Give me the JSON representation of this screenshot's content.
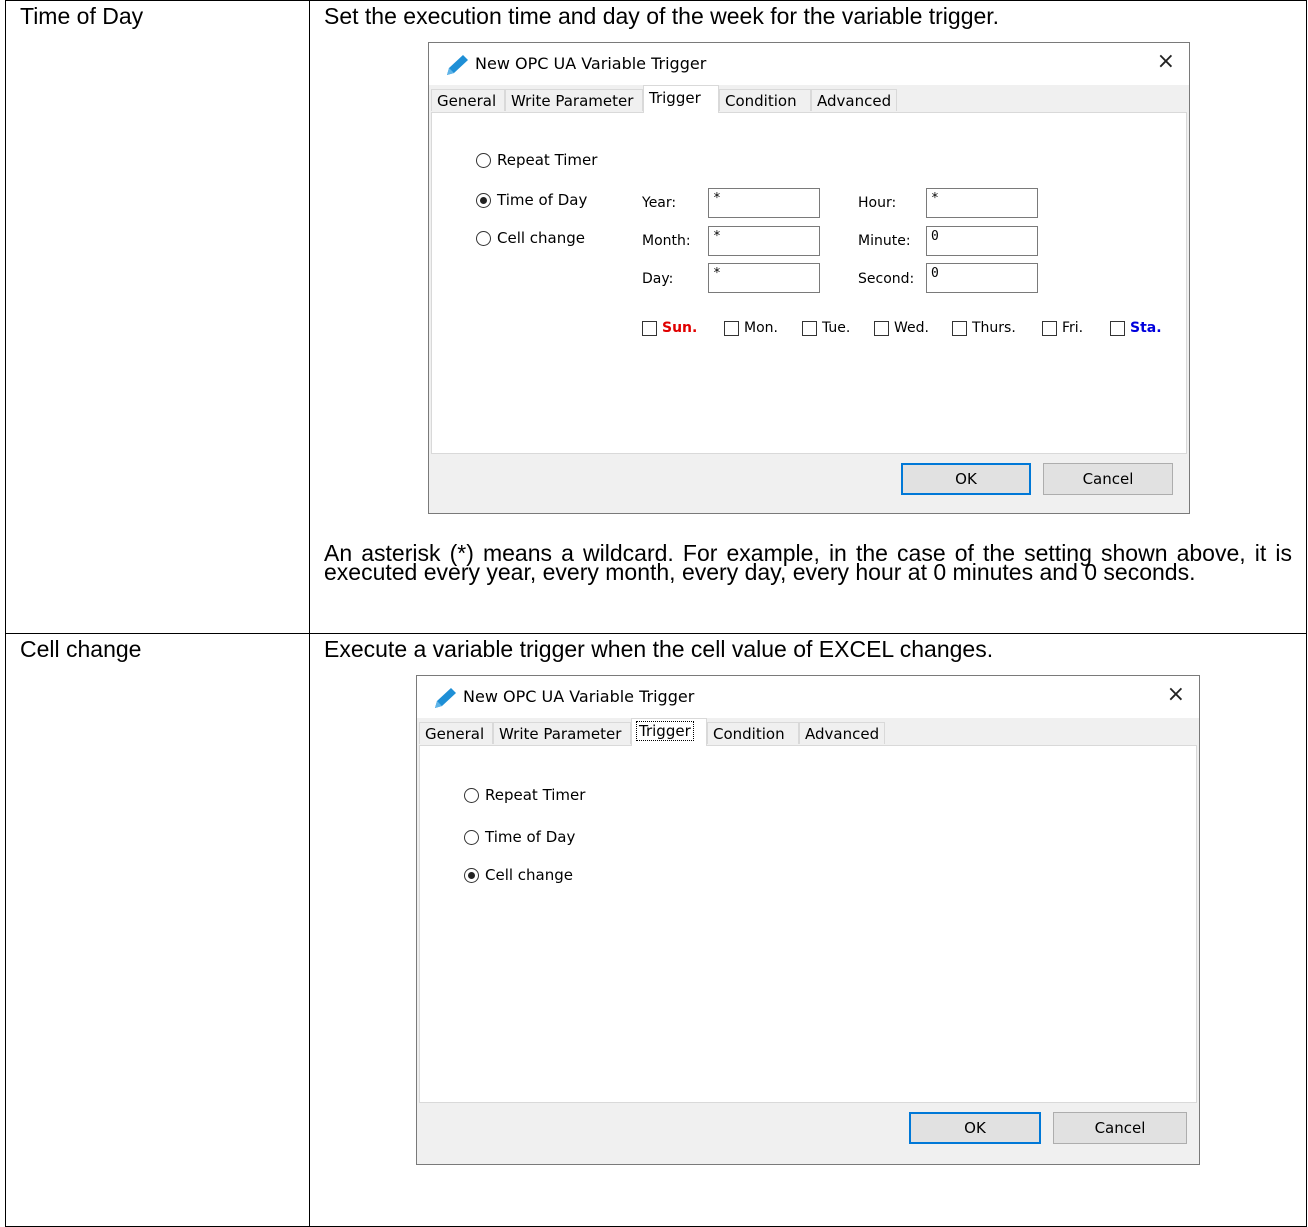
{
  "rows": [
    {
      "term": "Time of Day",
      "description": "Set the execution time and day of the week for the variable trigger.",
      "note": "An asterisk (*) means a wildcard. For example, in the case of the setting shown above, it is executed every year, every month, every day, every hour at 0 minutes and 0 seconds.",
      "dialog": {
        "title": "New OPC UA Variable Trigger",
        "close_glyph": "×",
        "tabs": [
          "General",
          "Write Parameter",
          "Trigger",
          "Condition",
          "Advanced"
        ],
        "radios": [
          "Repeat Timer",
          "Time of Day",
          "Cell change"
        ],
        "selected_radio": "Time of Day",
        "fields": {
          "year_label": "Year:",
          "year_value": "*",
          "month_label": "Month:",
          "month_value": "*",
          "day_label": "Day:",
          "day_value": "*",
          "hour_label": "Hour:",
          "hour_value": "*",
          "minute_label": "Minute:",
          "minute_value": "0",
          "second_label": "Second:",
          "second_value": "0"
        },
        "days": [
          "Sun.",
          "Mon.",
          "Tue.",
          "Wed.",
          "Thurs.",
          "Fri.",
          "Sta."
        ],
        "ok_label": "OK",
        "cancel_label": "Cancel"
      }
    },
    {
      "term": "Cell change",
      "description": "Execute a variable trigger when the cell value of EXCEL changes.",
      "dialog": {
        "title": "New OPC UA Variable Trigger",
        "close_glyph": "×",
        "tabs": [
          "General",
          "Write Parameter",
          "Trigger",
          "Condition",
          "Advanced"
        ],
        "radios": [
          "Repeat Timer",
          "Time of Day",
          "Cell change"
        ],
        "selected_radio": "Cell change",
        "ok_label": "OK",
        "cancel_label": "Cancel"
      }
    }
  ],
  "colors": {
    "sunday": "#e00000",
    "saturday": "#0000dd",
    "pencil_icon": "#1e8fd6",
    "default_button_border": "#0078d7"
  }
}
